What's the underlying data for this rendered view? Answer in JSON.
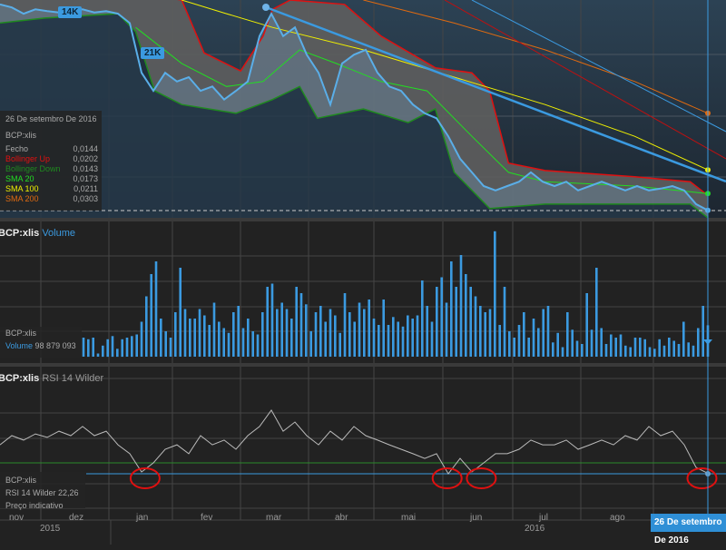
{
  "chart_data": [
    {
      "type": "line",
      "title": "BCP:xlis",
      "date": "26 De setembro De 2016",
      "legend": {
        "symbol": "BCP:xlis",
        "rows": [
          {
            "label": "Fecho",
            "value": "0,0144",
            "color": "#aaaaaa"
          },
          {
            "label": "Bollinger Up",
            "value": "0,0202",
            "color": "#e01010"
          },
          {
            "label": "Bollinger Down",
            "value": "0,0143",
            "color": "#1f8a1f"
          },
          {
            "label": "SMA 20",
            "value": "0,0173",
            "color": "#22dd22"
          },
          {
            "label": "SMA 100",
            "value": "0,0211",
            "color": "#f0f000"
          },
          {
            "label": "SMA 200",
            "value": "0,0303",
            "color": "#e06a10"
          }
        ]
      },
      "markers": [
        {
          "label": "14K",
          "t": 5.8
        },
        {
          "label": "21K",
          "t": 12.7
        }
      ],
      "ylim": [
        0.013,
        0.048
      ],
      "xlim": [
        0,
        61.5
      ],
      "price": [
        0.0473,
        0.0468,
        0.0458,
        0.0465,
        0.0462,
        0.046,
        0.0462,
        0.0465,
        0.046,
        0.0462,
        0.0458,
        0.0443,
        0.0363,
        0.0334,
        0.0363,
        0.0349,
        0.0356,
        0.0334,
        0.0341,
        0.032,
        0.0334,
        0.0349,
        0.0422,
        0.0458,
        0.0422,
        0.0436,
        0.0392,
        0.0363,
        0.0312,
        0.0378,
        0.0392,
        0.04,
        0.0363,
        0.0341,
        0.0334,
        0.0312,
        0.0298,
        0.029,
        0.0261,
        0.0225,
        0.0203,
        0.0181,
        0.0174,
        0.0181,
        0.0188,
        0.0203,
        0.0188,
        0.0181,
        0.0188,
        0.0174,
        0.0181,
        0.0188,
        0.0181,
        0.0174,
        0.0181,
        0.0174,
        0.0177,
        0.0181,
        0.0174,
        0.0152,
        0.0142
      ],
      "bollinger_up": {
        "t": [
          0,
          10,
          15.4,
          17.3,
          20.4,
          22.3,
          23.1,
          24.6,
          29.2,
          32.3,
          36.9,
          40,
          41.5,
          43.1,
          46.2,
          53.8,
          58.5,
          60
        ],
        "v": [
          0.0495,
          0.0495,
          0.048,
          0.0395,
          0.0366,
          0.0422,
          0.0465,
          0.048,
          0.0473,
          0.0422,
          0.0371,
          0.0363,
          0.0334,
          0.0218,
          0.0206,
          0.0196,
          0.0188,
          0.0166
        ]
      },
      "bollinger_down": {
        "t": [
          0,
          3.8,
          10,
          11.5,
          13.1,
          15.4,
          20,
          23.1,
          25.4,
          26.9,
          30.8,
          34.6,
          36.9,
          38.5,
          41.5,
          46.2,
          53.8,
          58.5,
          60
        ],
        "v": [
          0.0443,
          0.0451,
          0.0458,
          0.0429,
          0.0334,
          0.0312,
          0.0298,
          0.032,
          0.0341,
          0.029,
          0.0305,
          0.0283,
          0.0305,
          0.0203,
          0.0145,
          0.0152,
          0.0152,
          0.0152,
          0.013
        ]
      },
      "sma20": {
        "t": [
          11.5,
          15.4,
          19.2,
          22.3,
          25.4,
          28.5,
          32.3,
          36.2,
          40,
          43.1,
          46.2,
          53.8,
          60
        ],
        "v": [
          0.0436,
          0.0378,
          0.0341,
          0.0349,
          0.04,
          0.0378,
          0.0349,
          0.0334,
          0.0261,
          0.0203,
          0.0188,
          0.0181,
          0.0169
        ]
      },
      "sma100": {
        "t": [
          15.4,
          19.2,
          23.1,
          30.8,
          38.5,
          46.2,
          53.8,
          60
        ],
        "v": [
          0.048,
          0.0458,
          0.0436,
          0.04,
          0.0356,
          0.0312,
          0.0261,
          0.0207
        ]
      },
      "sma200": {
        "t": [
          30.8,
          38.5,
          46.2,
          53.8,
          60
        ],
        "v": [
          0.048,
          0.0443,
          0.04,
          0.0349,
          0.0298
        ]
      }
    },
    {
      "type": "bar",
      "title": "Volume",
      "symbol": "BCP:xlis",
      "info_symbol": "BCP:xlis",
      "info_label": "Volume",
      "info_value": "98 879 093",
      "ylim": [
        0,
        400
      ],
      "unit": "millions",
      "values": [
        60,
        55,
        60,
        10,
        35,
        55,
        65,
        25,
        55,
        60,
        65,
        70,
        110,
        190,
        260,
        300,
        120,
        80,
        60,
        140,
        280,
        150,
        120,
        120,
        150,
        130,
        100,
        170,
        110,
        90,
        75,
        140,
        160,
        90,
        120,
        80,
        70,
        140,
        220,
        230,
        150,
        170,
        150,
        120,
        220,
        200,
        165,
        80,
        140,
        160,
        110,
        150,
        130,
        75,
        200,
        140,
        110,
        170,
        150,
        180,
        120,
        100,
        180,
        100,
        125,
        110,
        95,
        130,
        120,
        130,
        240,
        160,
        110,
        220,
        250,
        170,
        300,
        220,
        320,
        260,
        220,
        190,
        160,
        140,
        150,
        395,
        100,
        220,
        80,
        60,
        100,
        140,
        60,
        120,
        90,
        150,
        160,
        45,
        75,
        30,
        140,
        85,
        50,
        40,
        200,
        85,
        280,
        90,
        40,
        70,
        60,
        70,
        35,
        30,
        60,
        60,
        55,
        30,
        25,
        55,
        35,
        60,
        50,
        40,
        110,
        45,
        35,
        90,
        160,
        99
      ]
    },
    {
      "type": "line",
      "title": "RSI 14 Wilder",
      "symbol": "BCP:xlis",
      "info_symbol": "BCP:xlis",
      "info_value": "RSI 14 Wilder 22,26",
      "info_note": "Preço indicativo",
      "ylim": [
        0,
        100
      ],
      "levels": [
        30,
        22.26
      ],
      "values": [
        43.3,
        50,
        46.7,
        51.3,
        48.7,
        53.3,
        50,
        56.7,
        50,
        53.3,
        43.3,
        36.7,
        23.3,
        30,
        40,
        43.3,
        36.7,
        50,
        43.3,
        46.7,
        40,
        50,
        56.7,
        68.7,
        53.3,
        60,
        50,
        43.3,
        53.3,
        46.7,
        56.7,
        50,
        46.7,
        43.3,
        40,
        36.7,
        33.3,
        36.7,
        22,
        33.3,
        23.3,
        30,
        36.7,
        36.7,
        40,
        46.7,
        43.3,
        43.3,
        46.7,
        40,
        43.3,
        46.7,
        43.3,
        50,
        46.7,
        56.7,
        50,
        53.3,
        43.3,
        26.7,
        22.26
      ],
      "highlighted_lows_t": [
        12.3,
        37.9,
        40.8,
        59.5
      ]
    }
  ],
  "axis": {
    "months": [
      "nov",
      "dez",
      "jan",
      "fev",
      "mar",
      "abr",
      "mai",
      "jun",
      "jul",
      "ago"
    ],
    "years": [
      "2015",
      "2016"
    ],
    "cursor_label": "26 De setembro De 2016"
  },
  "colors": {
    "price": "#5aaee8",
    "accent": "#2f8fd6",
    "circle": "#e01010"
  }
}
